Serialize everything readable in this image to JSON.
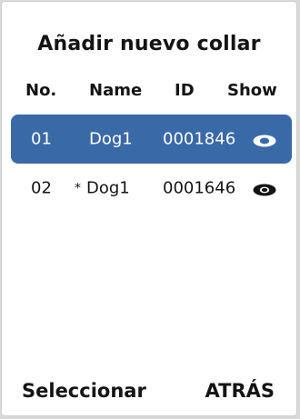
{
  "screen": {
    "title": "Añadir nuevo collar"
  },
  "table": {
    "headers": {
      "no": "No.",
      "name": "Name",
      "id": "ID",
      "show": "Show"
    },
    "rows": [
      {
        "no": "01",
        "name": "Dog1",
        "marker": "",
        "id": "0001846",
        "show_icon": "eye-open-icon",
        "selected": true
      },
      {
        "no": "02",
        "name": "Dog1",
        "marker": "*",
        "id": "0001646",
        "show_icon": "eye-filled-icon",
        "selected": false
      }
    ]
  },
  "footer": {
    "left_label": "Seleccionar",
    "right_label": "ATRÁS"
  },
  "colors": {
    "selected_row": "#3a69a8",
    "text": "#141414",
    "background": "#ffffff"
  }
}
